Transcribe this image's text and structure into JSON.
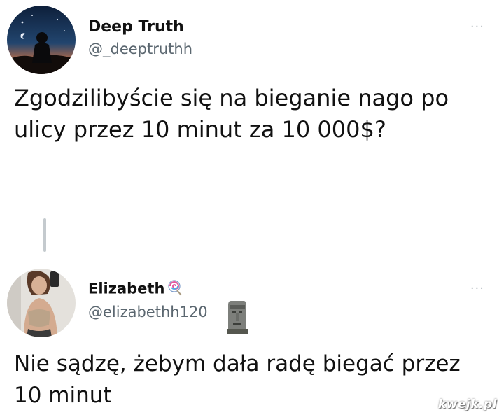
{
  "tweets": [
    {
      "display_name": "Deep Truth",
      "handle": "@_deeptruthh",
      "more_label": "···",
      "text": "Zgodzilibyście się na bieganie nago po ulicy przez 10 minut za 10 000$?"
    },
    {
      "display_name": "Elizabeth",
      "name_emoji": "lollipop-icon",
      "handle": "@elizabethh120",
      "handle_emoji": "moai-icon",
      "more_label": "···",
      "text": "Nie sądzę, żebym dała radę biegać przez 10 minut"
    }
  ],
  "watermark": "kwejk.pl",
  "colors": {
    "text": "#111111",
    "handle": "#5b6770",
    "thread_line": "#c4cace",
    "more": "#b8bec3"
  }
}
